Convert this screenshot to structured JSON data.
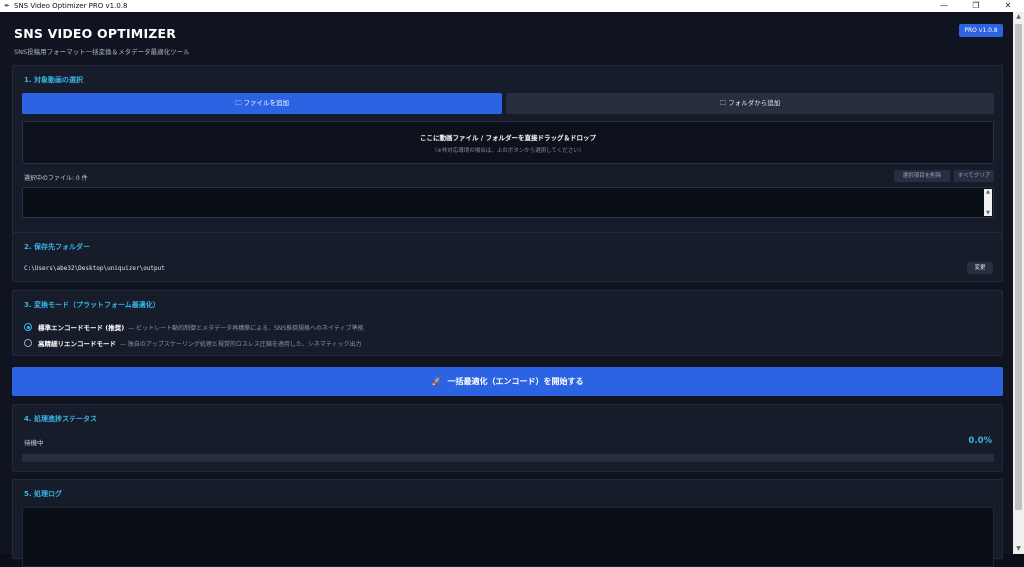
{
  "window": {
    "icon": "feather-icon",
    "title": "SNS Video Optimizer PRO v1.0.8",
    "minimize": "—",
    "maximize": "❐",
    "close": "✕"
  },
  "header": {
    "title": "SNS VIDEO OPTIMIZER",
    "subtitle": "SNS投稿用フォーマット一括変換＆メタデータ最適化ツール",
    "badge": "PRO v1.0.8"
  },
  "section1": {
    "title": "1. 対象動画の選択",
    "add_file": "ファイルを追加",
    "add_folder": "フォルダから追加",
    "drop_main": "ここに動画ファイル / フォルダーを直接ドラッグ＆ドロップ",
    "drop_sub": "（※非対応環境の場合は、上のボタンから選択してください）",
    "selected_label": "選択中のファイル: 0 件",
    "remove_selected": "選択項目を削除",
    "clear_all": "すべてクリア"
  },
  "section2": {
    "title": "2. 保存先フォルダー",
    "path": "C:\\Users\\abe32\\Desktop\\uniquizer\\output",
    "change": "変更"
  },
  "section3": {
    "title": "3. 変換モード（プラットフォーム最適化）",
    "options": [
      {
        "label": "標準エンコードモード (推奨)",
        "desc": "— ビットレート動的制御とメタデータ再構築による、SNS推奨規格へのネイティブ準拠",
        "selected": true
      },
      {
        "label": "高精細リエンコードモード",
        "desc": "— 独自のアップスケーリング処理と視覚的ロスレス圧縮を適用した、シネマティック出力",
        "selected": false
      }
    ]
  },
  "start": {
    "label": "一括最適化（エンコード）を開始する"
  },
  "section4": {
    "title": "4. 処理進捗ステータス",
    "status": "待機中",
    "percent": "0.0%",
    "progress": 0
  },
  "section5": {
    "title": "5. 処理ログ"
  },
  "colors": {
    "accent": "#2b63e3",
    "heading": "#38b6e8",
    "background": "#0f1420",
    "panel": "#161c2a"
  }
}
